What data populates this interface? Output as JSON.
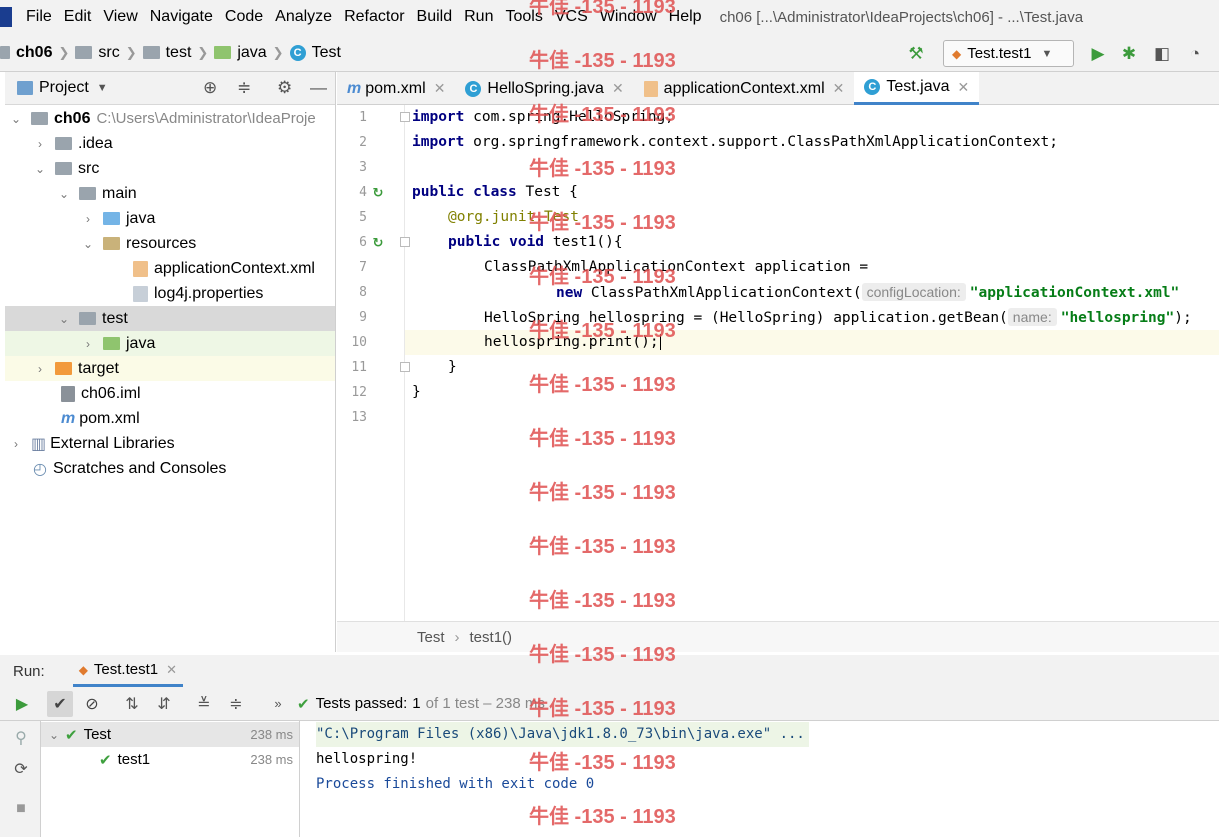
{
  "menu": [
    "File",
    "Edit",
    "View",
    "Navigate",
    "Code",
    "Analyze",
    "Refactor",
    "Build",
    "Run",
    "Tools",
    "VCS",
    "Window",
    "Help"
  ],
  "window_title": "ch06 [...\\Administrator\\IdeaProjects\\ch06] - ...\\Test.java",
  "breadcrumb": [
    "ch06",
    "src",
    "test",
    "java",
    "Test"
  ],
  "run_config": "Test.test1",
  "project_panel": {
    "title": "Project",
    "tree": [
      {
        "label": "ch06",
        "extra": "C:\\Users\\Administrator\\IdeaProje"
      },
      {
        "label": ".idea"
      },
      {
        "label": "src"
      },
      {
        "label": "main"
      },
      {
        "label": "java"
      },
      {
        "label": "resources"
      },
      {
        "label": "applicationContext.xml"
      },
      {
        "label": "log4j.properties"
      },
      {
        "label": "test"
      },
      {
        "label": "java"
      },
      {
        "label": "target"
      },
      {
        "label": "ch06.iml"
      },
      {
        "label": "pom.xml"
      },
      {
        "label": "External Libraries"
      },
      {
        "label": "Scratches and Consoles"
      }
    ]
  },
  "tabs": [
    "pom.xml",
    "HelloSpring.java",
    "applicationContext.xml",
    "Test.java"
  ],
  "code": {
    "line_numbers": [
      "1",
      "2",
      "3",
      "4",
      "5",
      "6",
      "7",
      "8",
      "9",
      "10",
      "11",
      "12",
      "13"
    ],
    "l1_kw": "import",
    "l1": " com.spring.HelloSpring;",
    "l2_kw": "import",
    "l2": " org.springframework.context.support.ClassPathXmlApplicationContext;",
    "l4_kw": "public class",
    "l4": " Test {",
    "l5": "@org.junit.Test",
    "l6_kw": "public void",
    "l6": " test1(){",
    "l7": "ClassPathXmlApplicationContext application =",
    "l8_kw": "new",
    "l8": " ClassPathXmlApplicationContext(",
    "l8_hint": "configLocation:",
    "l8_str": "\"applicationContext.xml\"",
    "l9": "HelloSpring hellospring = (HelloSpring) application.getBean(",
    "l9_hint": "name:",
    "l9_str": "\"hellospring\"",
    "l9_end": ");",
    "l10": "hellospring.print();",
    "l11": "}",
    "l12": "}"
  },
  "editor_breadcrumb": [
    "Test",
    "test1()"
  ],
  "run": {
    "label": "Run:",
    "tab": "Test.test1",
    "status_prefix": "Tests passed:",
    "status_count": "1",
    "status_rest": "of 1 test – 238 ms",
    "tests": [
      {
        "name": "Test",
        "time": "238 ms"
      },
      {
        "name": "test1",
        "time": "238 ms"
      }
    ],
    "console": [
      "\"C:\\Program Files (x86)\\Java\\jdk1.8.0_73\\bin\\java.exe\" ...",
      "hellospring!",
      "Process finished with exit code 0"
    ]
  },
  "watermark": "牛佳 -135 - 1193"
}
